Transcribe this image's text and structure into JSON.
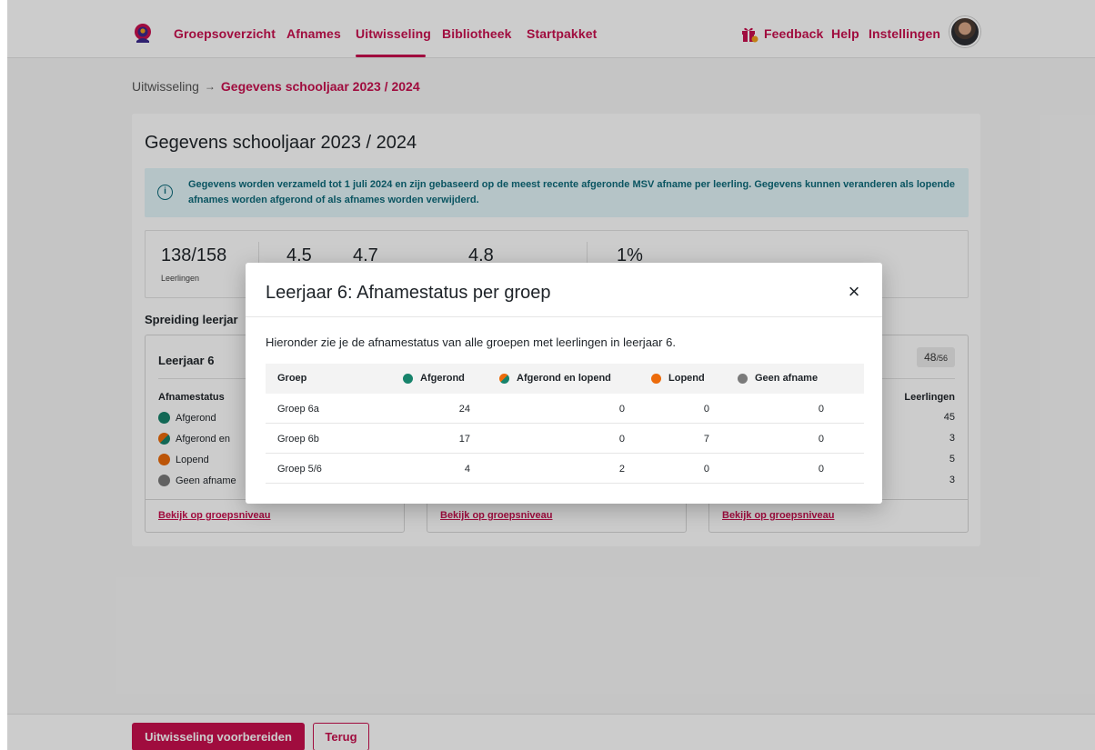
{
  "nav": {
    "items": [
      "Groepsoverzicht",
      "Afnames",
      "Uitwisseling",
      "Bibliotheek",
      "Startpakket"
    ],
    "active": "Uitwisseling",
    "right_items": [
      "Feedback",
      "Help",
      "Instellingen"
    ],
    "logo_icon": "logo-icon",
    "gift_icon": "gift-icon",
    "avatar_icon": "avatar"
  },
  "breadcrumb": {
    "parent": "Uitwisseling",
    "separator": "→",
    "current": "Gegevens schooljaar 2023 / 2024"
  },
  "page": {
    "title": "Gegevens schooljaar 2023 / 2024",
    "info": "Gegevens worden verzameld tot 1 juli 2024 en zijn gebaseerd op de meest recente afgeronde MSV afname per leerling. Gegevens kunnen veranderen als lopende afnames worden afgerond of als afnames worden verwijderd.",
    "stats": [
      {
        "value": "138/158",
        "label": "Leerlingen"
      },
      {
        "value": "4.5",
        "label": ""
      },
      {
        "value": "4.7",
        "label": ""
      },
      {
        "value": "4.8",
        "label": ""
      },
      {
        "value": "1%",
        "label": ""
      }
    ],
    "spread_title": "Spreiding leerjar",
    "cards": [
      {
        "title": "Leerjaar 6",
        "status_head": "Afnamestatus",
        "statuses": [
          "Afgerond",
          "Afgerond en",
          "Lopend",
          "Geen afname"
        ],
        "link": "Bekijk op groepsniveau"
      },
      {
        "link": "Bekijk op groepsniveau"
      },
      {
        "pill_value": "48",
        "pill_total": "/56",
        "col_head": "Leerlingen",
        "counts": [
          "45",
          "3",
          "5",
          "3"
        ],
        "link": "Bekijk op groepsniveau"
      }
    ]
  },
  "footer": {
    "primary": "Uitwisseling voorbereiden",
    "secondary": "Terug"
  },
  "modal": {
    "title": "Leerjaar 6: Afnamestatus per groep",
    "close": "×",
    "description": "Hieronder zie je de afnamestatus van alle groepen met leerlingen in leerjaar 6.",
    "columns": [
      "Groep",
      "Afgerond",
      "Afgerond en lopend",
      "Lopend",
      "Geen afname"
    ],
    "rows": [
      {
        "group": "Groep 6a",
        "afgerond": "24",
        "afgerond_lopend": "0",
        "lopend": "0",
        "geen": "0"
      },
      {
        "group": "Groep 6b",
        "afgerond": "17",
        "afgerond_lopend": "0",
        "lopend": "7",
        "geen": "0"
      },
      {
        "group": "Groep 5/6",
        "afgerond": "4",
        "afgerond_lopend": "2",
        "lopend": "0",
        "geen": "0"
      }
    ]
  },
  "colors": {
    "brand": "#c8104e",
    "afgerond": "#17836b",
    "lopend": "#ec6b0b",
    "geen_afname": "#7a7a7a",
    "info_bg": "#e3f6f9",
    "info_text": "#0d6a7a"
  }
}
